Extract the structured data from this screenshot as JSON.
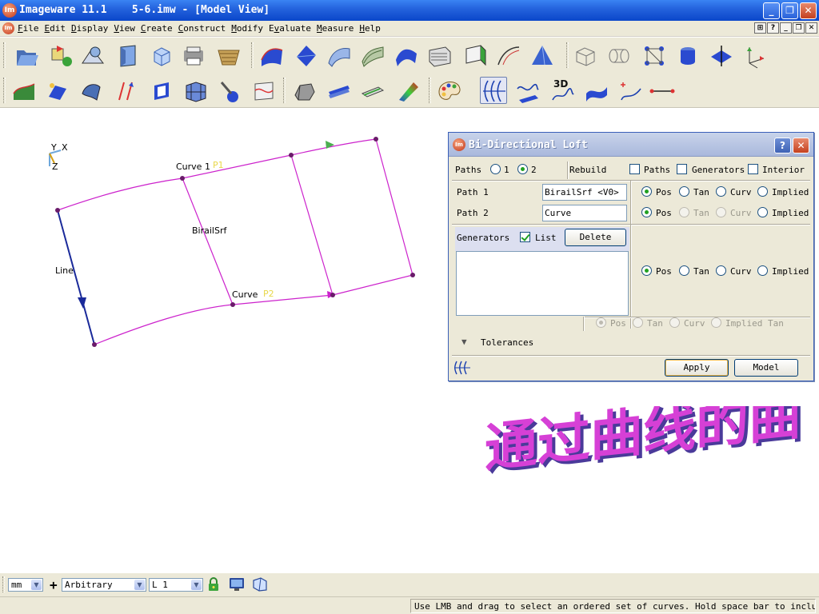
{
  "window": {
    "title": "Imageware 11.1    5-6.imw - [Model View]",
    "logo": "Im",
    "controls": [
      "minimize-icon",
      "restore-icon",
      "close-icon"
    ]
  },
  "menu": {
    "items": [
      {
        "label": "File",
        "underline": "F",
        "rest": "ile"
      },
      {
        "label": "Edit",
        "underline": "E",
        "rest": "dit"
      },
      {
        "label": "Display",
        "underline": "D",
        "rest": "isplay"
      },
      {
        "label": "View",
        "underline": "V",
        "rest": "iew"
      },
      {
        "label": "Create",
        "underline": "C",
        "rest": "reate"
      },
      {
        "label": "Construct",
        "underline": "C",
        "rest": "onstruct"
      },
      {
        "label": "Modify",
        "underline": "M",
        "rest": "odify"
      },
      {
        "label": "Evaluate",
        "underline": "v",
        "rest": "aluate",
        "prefix": "E"
      },
      {
        "label": "Measure",
        "underline": "M",
        "rest": "easure"
      },
      {
        "label": "Help",
        "underline": "H",
        "rest": "elp"
      }
    ],
    "mdi_buttons": [
      "toolbar-toggle-icon",
      "help-icon",
      "minimize-icon",
      "restore-icon",
      "close-icon"
    ]
  },
  "toolbar1": {
    "icons": [
      "open-file-icon",
      "import-icon",
      "scan-icon",
      "section-icon",
      "cube-icon",
      "print-icon",
      "basket-icon",
      "surface-blue-icon",
      "surface-diamond-icon",
      "surface-curl-icon",
      "surface-twist-icon",
      "surface-wave-icon",
      "surface-sheet-icon",
      "surface-fold-icon",
      "surface-curve-icon",
      "pyramid-icon",
      "wire-box-icon",
      "wire-tube-icon",
      "node-network-icon",
      "cylinder-icon",
      "plane-icon",
      "axis-icon"
    ]
  },
  "toolbar2": {
    "icons": [
      "terrain-icon",
      "flatten-icon",
      "shell-icon",
      "offset-icon",
      "ring-icon",
      "box-mesh-icon",
      "joint-icon",
      "trim-icon",
      "sweep-icon",
      "extrude-icon",
      "plate-icon",
      "color-map-icon",
      "palette-icon",
      "bi-directional-loft-icon",
      "surface-from-curves-icon",
      "3d-curve-icon",
      "blend-surface-icon",
      "curve-point-icon",
      "line-segment-icon"
    ],
    "label_3d": "3D"
  },
  "scene": {
    "axis_labels": {
      "y": "Y",
      "x": "X",
      "z": "Z"
    },
    "labels": {
      "curve1": "Curve 1",
      "p1": "P1",
      "birail": "BirailSrf",
      "line": "Line",
      "curve": "Curve",
      "p2": "P2"
    },
    "colors": {
      "curve": "#cc22cc",
      "line": "#1a2a9a",
      "arrow": "#4caf50",
      "point": "#e8d84a"
    }
  },
  "dialog": {
    "title": "Bi-Directional Loft",
    "paths_label": "Paths",
    "paths_options": [
      "1",
      "2"
    ],
    "paths_selected": "2",
    "rebuild_label": "Rebuild",
    "rebuild_options": [
      {
        "label": "Paths",
        "checked": false
      },
      {
        "label": "Generators",
        "checked": false
      },
      {
        "label": "Interior",
        "checked": false
      }
    ],
    "path1": {
      "label": "Path 1",
      "value": "BirailSrf <V0>",
      "continuity": "Pos"
    },
    "path2": {
      "label": "Path 2",
      "value": "Curve",
      "continuity": "Pos"
    },
    "continuity_options": [
      "Pos",
      "Tan",
      "Curv",
      "Implied"
    ],
    "generators": {
      "label": "Generators",
      "list_label": "List",
      "list_checked": true,
      "delete_label": "Delete",
      "continuity": "Pos"
    },
    "bottom_continuity": [
      "Pos",
      "Tan",
      "Curv",
      "Implied Tan"
    ],
    "tolerances_label": "Tolerances",
    "apply_label": "Apply",
    "model_label": "Model"
  },
  "caption": {
    "text": "通过曲线的曲面",
    "color": "#d640d6"
  },
  "bottombar": {
    "units": "mm",
    "orientation": "Arbitrary",
    "layer": "L 1",
    "plus": "+"
  },
  "status": {
    "message": "Use LMB and drag to select an ordered set of curves. Hold space bar to include surfa"
  }
}
